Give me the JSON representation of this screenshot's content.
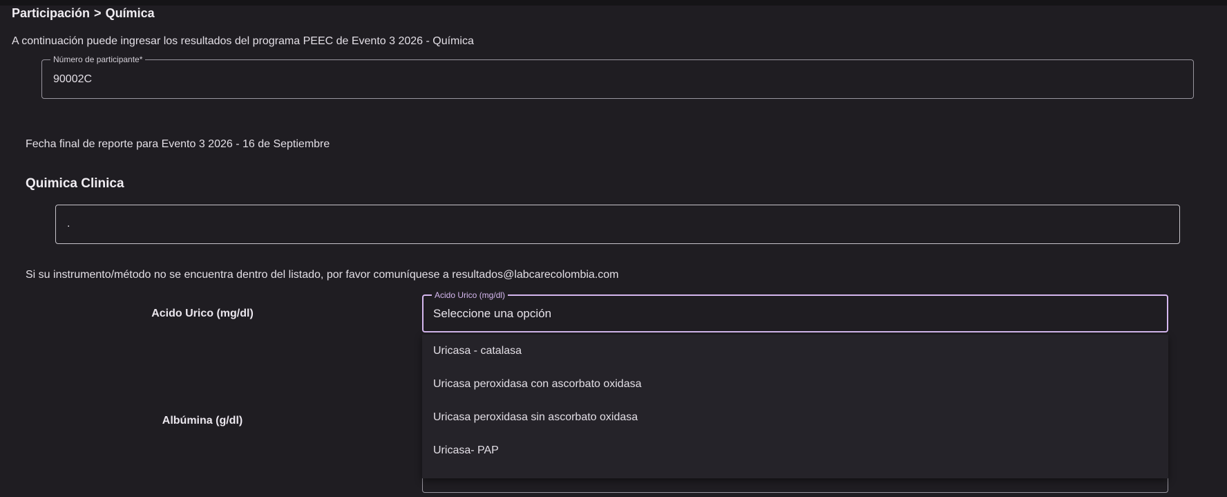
{
  "breadcrumb": {
    "parent": "Participación",
    "separator": ">",
    "current": "Química"
  },
  "intro_text": "A continuación puede ingresar los resultados del programa PEEC de Evento 3 2026 - Química",
  "participant": {
    "label": "Número de participante*",
    "value": "90002C"
  },
  "deadline_text": "Fecha final de reporte para Evento 3 2026 - 16 de Septiembre",
  "section": {
    "title": "Quimica Clinica"
  },
  "instrument_field": {
    "value": "."
  },
  "notice_text": "Si su instrumento/método no se encuentra dentro del listado, por favor comuníquese a resultados@labcarecolombia.com",
  "analytes": [
    {
      "label": "Acido Urico (mg/dl)",
      "select_label": "Acido Urico (mg/dl)",
      "select_value": "Seleccione una opción",
      "options": [
        "Uricasa - catalasa",
        "Uricasa peroxidasa con ascorbato oxidasa",
        "Uricasa peroxidasa sin ascorbato oxidasa",
        "Uricasa- PAP"
      ]
    },
    {
      "label": "Albúmina (g/dl)"
    }
  ],
  "colors": {
    "background": "#1f1d22",
    "accent": "#d6b8f0",
    "outline": "#9a97a0",
    "menu_background": "#252329"
  }
}
